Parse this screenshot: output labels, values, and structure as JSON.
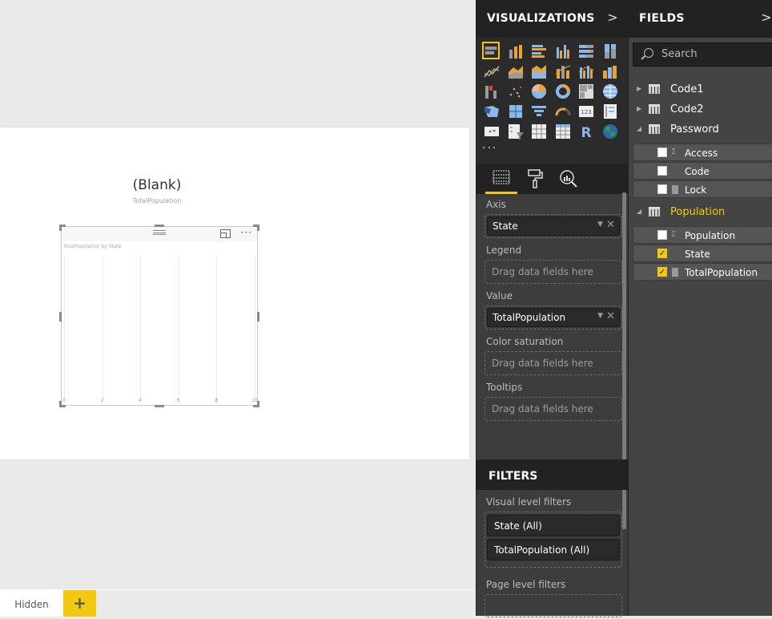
{
  "canvas": {
    "card": {
      "value": "(Blank)",
      "label": "TotalPopulation"
    },
    "visual": {
      "title": "TotalPopulation by State",
      "x_ticks": [
        "0",
        "2",
        "4",
        "6",
        "8",
        "10"
      ]
    }
  },
  "page_tabs": {
    "tabs": [
      {
        "label": "Hidden"
      }
    ],
    "add_label": "+"
  },
  "visualizations": {
    "title": "VISUALIZATIONS",
    "collapse_glyph": ">",
    "gallery_icons": [
      "stacked-bar-chart",
      "stacked-column-chart",
      "clustered-bar-chart",
      "clustered-column-chart",
      "100-stacked-bar-chart",
      "100-stacked-column-chart",
      "line-chart",
      "area-chart",
      "stacked-area-chart",
      "line-and-stacked-column-chart",
      "line-and-clustered-column-chart",
      "ribbon-chart",
      "waterfall-chart",
      "scatter-chart",
      "pie-chart",
      "donut-chart",
      "treemap",
      "map",
      "filled-map",
      "shape-map",
      "funnel",
      "gauge",
      "card",
      "multi-row-card",
      "kpi",
      "slicer",
      "table",
      "matrix",
      "r-script-visual",
      "globe-map"
    ],
    "selected_icon": 0,
    "more_label": "...",
    "tabs": [
      "fields-tab",
      "format-tab",
      "analytics-tab"
    ],
    "wells": {
      "axis": {
        "label": "Axis",
        "value": "State"
      },
      "legend": {
        "label": "Legend",
        "placeholder": "Drag data fields here"
      },
      "value": {
        "label": "Value",
        "value": "TotalPopulation"
      },
      "color_saturation": {
        "label": "Color saturation",
        "placeholder": "Drag data fields here"
      },
      "tooltips": {
        "label": "Tooltips",
        "placeholder": "Drag data fields here"
      }
    }
  },
  "filters": {
    "title": "FILTERS",
    "visual_level_label": "Visual level filters",
    "visual_level": [
      "State  (All)",
      "TotalPopulation  (All)"
    ],
    "page_level_label": "Page level filters"
  },
  "fields": {
    "title": "FIELDS",
    "collapse_glyph": ">",
    "search_placeholder": "Search",
    "tables": [
      {
        "name": "Code1",
        "expanded": false
      },
      {
        "name": "Code2",
        "expanded": false
      },
      {
        "name": "Password",
        "expanded": true,
        "fields": [
          {
            "name": "Access",
            "type": "sum",
            "checked": false
          },
          {
            "name": "Code",
            "type": "text",
            "checked": false
          },
          {
            "name": "Lock",
            "type": "measure",
            "checked": false
          }
        ]
      },
      {
        "name": "Population",
        "expanded": true,
        "highlighted": true,
        "fields": [
          {
            "name": "Population",
            "type": "sum",
            "checked": false
          },
          {
            "name": "State",
            "type": "text",
            "checked": true
          },
          {
            "name": "TotalPopulation",
            "type": "measure",
            "checked": true
          }
        ]
      }
    ]
  },
  "colors": {
    "accent": "#f2c811",
    "pane_dark": "#222222",
    "pane_mid": "#3d3d3d"
  }
}
